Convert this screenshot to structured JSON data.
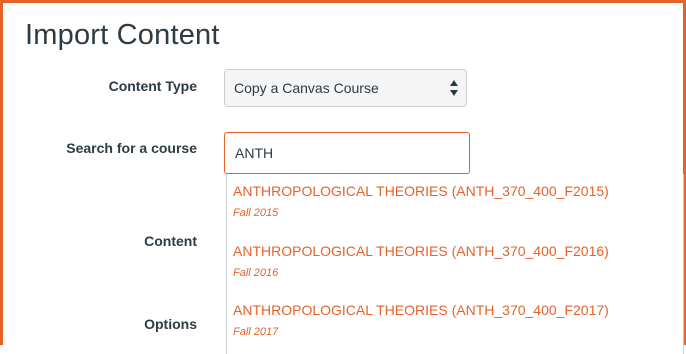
{
  "page": {
    "title": "Import Content"
  },
  "form": {
    "content_type_label": "Content Type",
    "content_type_value": "Copy a Canvas Course",
    "search_label": "Search for a course",
    "search_value": "ANTH",
    "content_label": "Content",
    "options_label": "Options"
  },
  "results": [
    {
      "name": "ANTHROPOLOGICAL THEORIES (ANTH_370_400_F2015)",
      "term": "Fall 2015"
    },
    {
      "name": "ANTHROPOLOGICAL THEORIES (ANTH_370_400_F2016)",
      "term": "Fall 2016"
    },
    {
      "name": "ANTHROPOLOGICAL THEORIES (ANTH_370_400_F2017)",
      "term": "Fall 2017"
    }
  ],
  "colors": {
    "accent": "#e4632b",
    "text": "#2d3b45",
    "border": "#c7cdd1"
  }
}
